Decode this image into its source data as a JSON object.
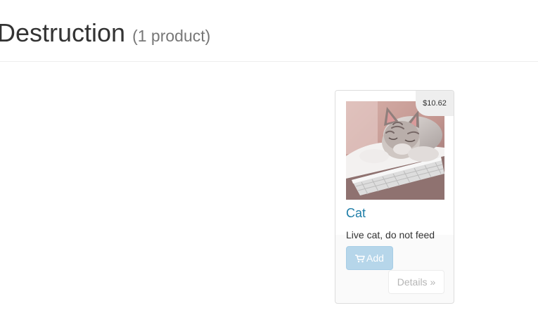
{
  "header": {
    "title": "Destruction",
    "count": "(1 product)"
  },
  "products": [
    {
      "name": "Cat",
      "price": "$10.62",
      "description": "Live cat, do not feed",
      "image_icon": "kitten-on-keyboard",
      "add_label": "Add",
      "details_label": "Details »"
    }
  ],
  "colors": {
    "link": "#1f7ea8",
    "add_button_bg": "#b6d6ea",
    "badge_bg": "#eeeeee"
  }
}
